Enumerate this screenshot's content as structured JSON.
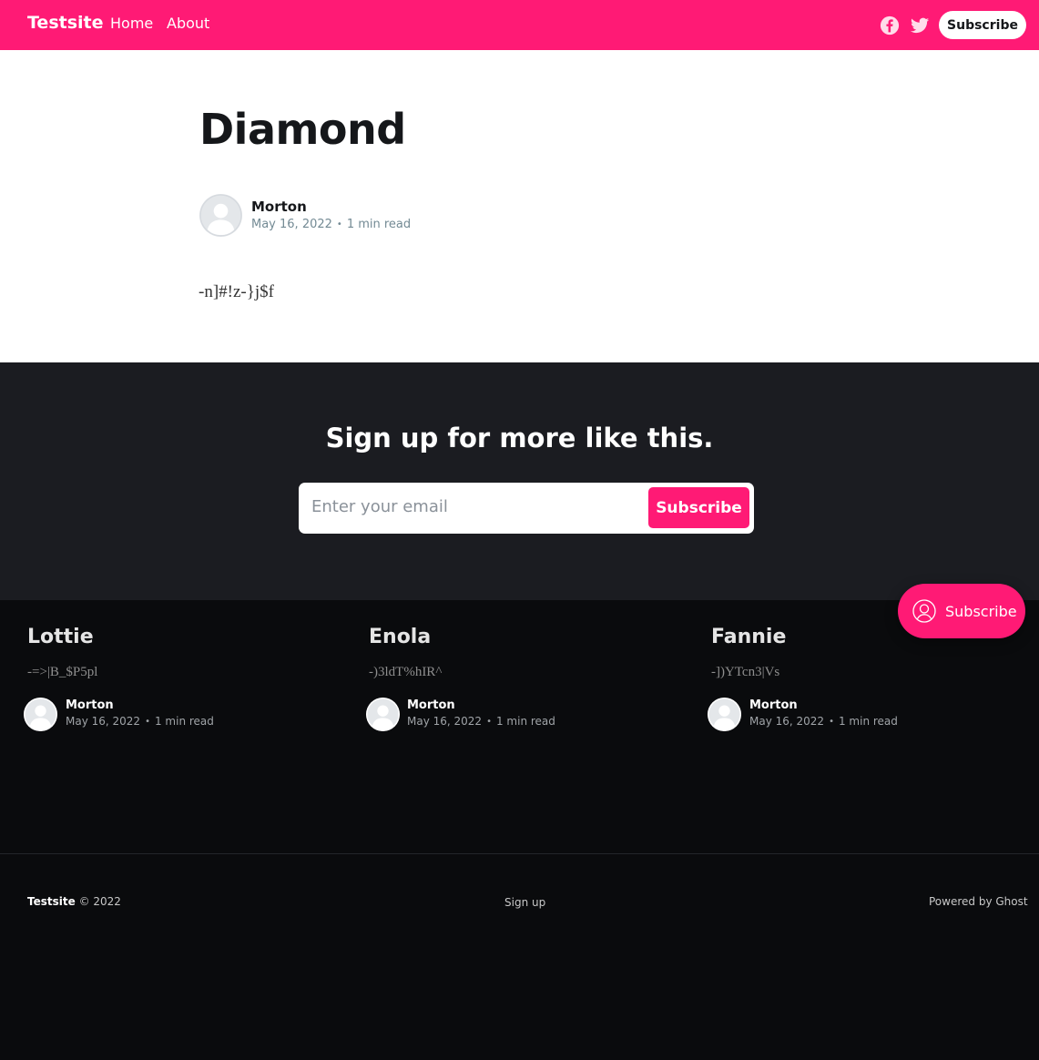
{
  "header": {
    "logo": "Testsite",
    "nav": [
      "Home",
      "About"
    ],
    "icons": [
      "facebook-icon",
      "twitter-icon"
    ],
    "subscribe_label": "Subscribe",
    "brand_color": "#ff1a75"
  },
  "post": {
    "title": "Diamond",
    "author": "Morton",
    "date": "May 16, 2022",
    "reading_time": "1 min read",
    "excerpt": "-n]#!z-}j$f"
  },
  "cta": {
    "title": "Sign up for more like this.",
    "email_placeholder": "Enter your email",
    "button_label": "Subscribe"
  },
  "portal": {
    "label": "Subscribe"
  },
  "related": [
    {
      "title": "Lottie",
      "excerpt": "-=>|B_$P5pl",
      "author": "Morton",
      "date": "May 16, 2022",
      "reading_time": "1 min read"
    },
    {
      "title": "Enola",
      "excerpt": "-)3ldT%hIR^",
      "author": "Morton",
      "date": "May 16, 2022",
      "reading_time": "1 min read"
    },
    {
      "title": "Fannie",
      "excerpt": "-])YTcn3|Vs",
      "author": "Morton",
      "date": "May 16, 2022",
      "reading_time": "1 min read"
    }
  ],
  "footer": {
    "brand": "Testsite",
    "copyright": "© 2022",
    "signup": "Sign up",
    "powered": "Powered by Ghost"
  }
}
